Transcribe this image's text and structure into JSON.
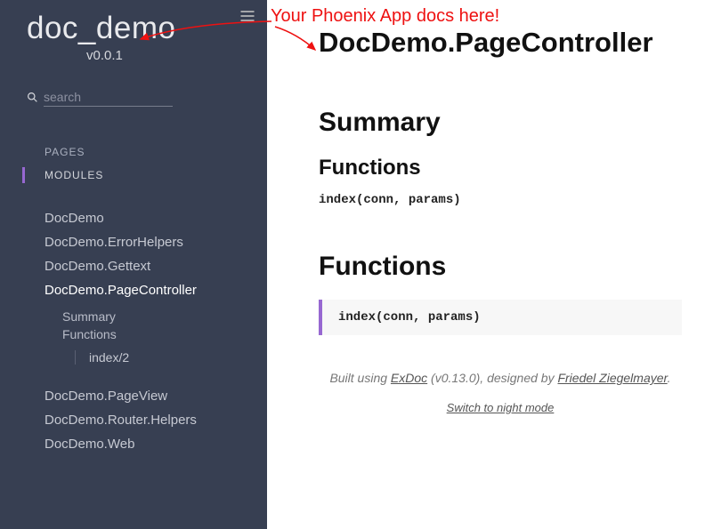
{
  "sidebar": {
    "title": "doc_demo",
    "version": "v0.0.1",
    "search_placeholder": "search",
    "tabs": [
      {
        "label": "PAGES"
      },
      {
        "label": "MODULES"
      }
    ],
    "modules": [
      {
        "label": "DocDemo"
      },
      {
        "label": "DocDemo.ErrorHelpers"
      },
      {
        "label": "DocDemo.Gettext"
      },
      {
        "label": "DocDemo.PageController",
        "children": [
          {
            "label": "Summary"
          },
          {
            "label": "Functions",
            "fns": [
              {
                "label": "index/2"
              }
            ]
          }
        ]
      },
      {
        "label": "DocDemo.PageView"
      },
      {
        "label": "DocDemo.Router.Helpers"
      },
      {
        "label": "DocDemo.Web"
      }
    ]
  },
  "main": {
    "title": "DocDemo.PageController",
    "summary_heading": "Summary",
    "functions_sub": "Functions",
    "signature_plain": "index(conn, params)",
    "functions_heading": "Functions",
    "fn_block": "index(conn, params)",
    "footer_built": "Built using ",
    "footer_exdoc": "ExDoc",
    "footer_version": " (v0.13.0), designed by ",
    "footer_designer": "Friedel Ziegelmayer",
    "footer_period": ".",
    "switch": "Switch to night mode"
  },
  "annotation": {
    "text": "Your Phoenix App docs here!"
  }
}
